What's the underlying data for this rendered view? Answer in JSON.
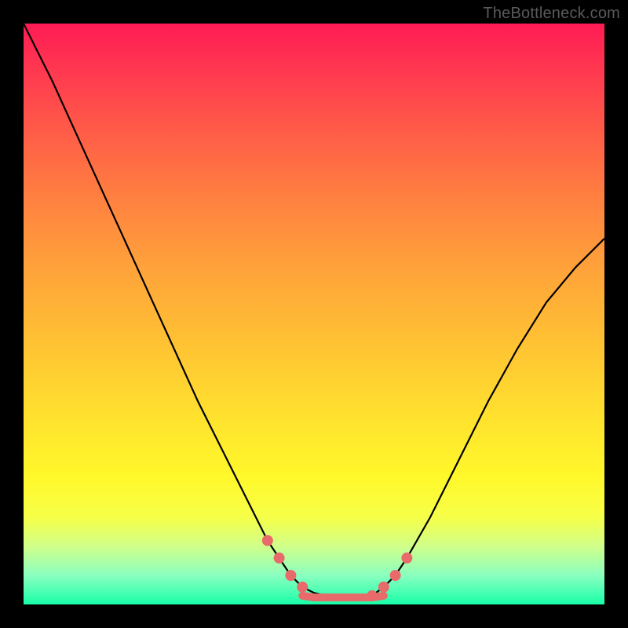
{
  "watermark": "TheBottleneck.com",
  "chart_data": {
    "type": "line",
    "title": "",
    "xlabel": "",
    "ylabel": "",
    "xlim": [
      0,
      100
    ],
    "ylim": [
      0,
      100
    ],
    "grid": false,
    "legend": false,
    "series": [
      {
        "name": "left-curve",
        "color": "#000000",
        "x": [
          0,
          5,
          10,
          15,
          20,
          25,
          30,
          35,
          40,
          42,
          44,
          46,
          48,
          50,
          52
        ],
        "values": [
          100,
          90,
          79,
          68,
          57,
          46,
          35,
          25,
          15,
          11,
          8,
          5,
          3,
          2,
          1.5
        ]
      },
      {
        "name": "right-curve",
        "color": "#000000",
        "x": [
          60,
          62,
          64,
          66,
          70,
          75,
          80,
          85,
          90,
          95,
          100
        ],
        "values": [
          1.5,
          3,
          5,
          8,
          15,
          25,
          35,
          44,
          52,
          58,
          63
        ]
      },
      {
        "name": "bottom-flat",
        "color": "#e86a6a",
        "x": [
          48,
          50,
          52,
          54,
          56,
          58,
          60,
          62
        ],
        "values": [
          1.5,
          1.2,
          1.2,
          1.2,
          1.2,
          1.2,
          1.2,
          1.5
        ]
      },
      {
        "name": "corner-dots-left",
        "type": "scatter",
        "color": "#e86a6a",
        "x": [
          42,
          44,
          46,
          48
        ],
        "values": [
          11,
          8,
          5,
          3
        ]
      },
      {
        "name": "corner-dots-right",
        "type": "scatter",
        "color": "#e86a6a",
        "x": [
          60,
          62,
          64,
          66
        ],
        "values": [
          1.5,
          3,
          5,
          8
        ]
      }
    ],
    "gradient_stops": [
      {
        "pos": 0,
        "color": "#ff1b55"
      },
      {
        "pos": 8,
        "color": "#ff3850"
      },
      {
        "pos": 18,
        "color": "#ff5a48"
      },
      {
        "pos": 30,
        "color": "#ff8040"
      },
      {
        "pos": 42,
        "color": "#ffa23a"
      },
      {
        "pos": 55,
        "color": "#ffc233"
      },
      {
        "pos": 68,
        "color": "#ffe22e"
      },
      {
        "pos": 78,
        "color": "#fff82a"
      },
      {
        "pos": 85,
        "color": "#f6ff48"
      },
      {
        "pos": 90,
        "color": "#d0ff8a"
      },
      {
        "pos": 95,
        "color": "#8affc0"
      },
      {
        "pos": 100,
        "color": "#18ffa8"
      }
    ]
  }
}
